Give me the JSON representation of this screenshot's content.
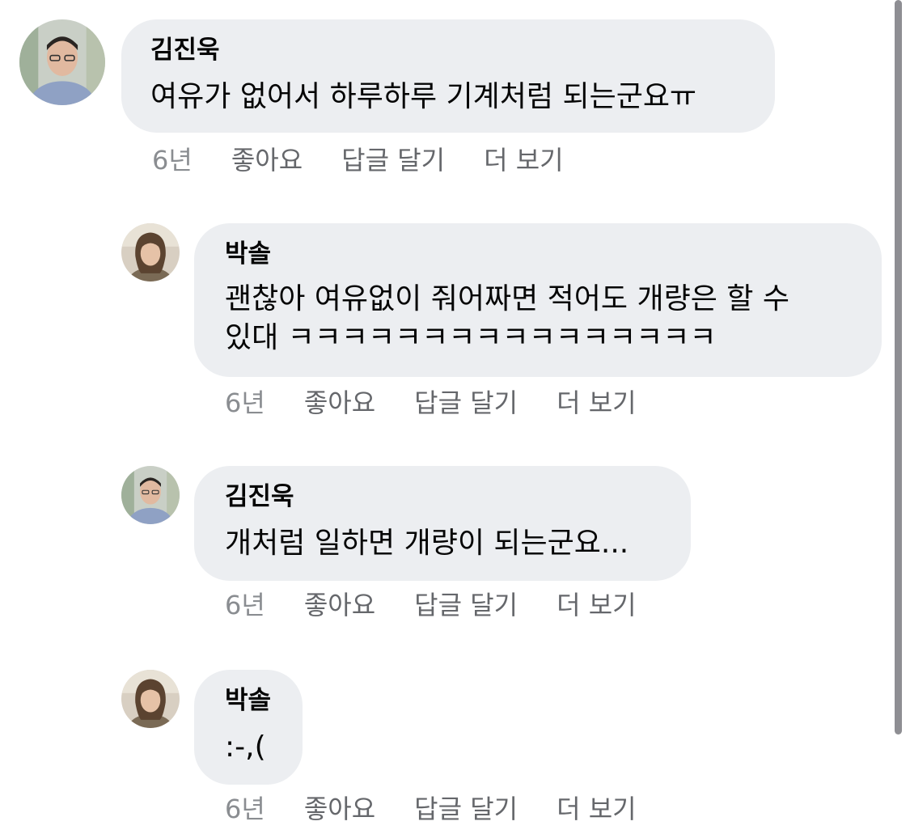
{
  "comments": [
    {
      "author": "김진욱",
      "text": "여유가 없어서 하루하루 기계처럼 되는군요ㅠ",
      "time": "6년",
      "like": "좋아요",
      "reply": "답글 달기",
      "more": "더 보기",
      "avatar": "man-with-glasses-avatar"
    },
    {
      "author": "박솔",
      "text": "괜찮아 여유없이 줘어짜면 적어도 개량은 할 수\n있대 ㅋㅋㅋㅋㅋㅋㅋㅋㅋㅋㅋㅋㅋㅋㅋㅋ",
      "time": "6년",
      "like": "좋아요",
      "reply": "답글 달기",
      "more": "더 보기",
      "avatar": "woman-avatar"
    },
    {
      "author": "김진욱",
      "text": "개처럼 일하면 개량이 되는군요...",
      "time": "6년",
      "like": "좋아요",
      "reply": "답글 달기",
      "more": "더 보기",
      "avatar": "man-with-glasses-avatar"
    },
    {
      "author": "박솔",
      "text": ":-,(",
      "time": "6년",
      "like": "좋아요",
      "reply": "답글 달기",
      "more": "더 보기",
      "avatar": "woman-avatar"
    }
  ],
  "colors": {
    "bubble": "#eceef1",
    "action_text": "#65676b",
    "scrollbar": "#8e8e93"
  }
}
